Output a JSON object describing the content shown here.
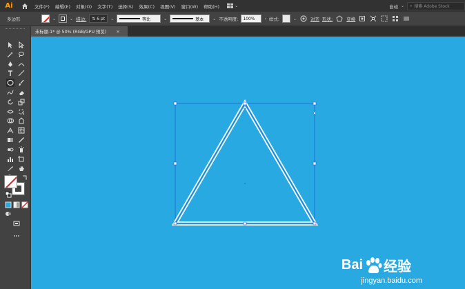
{
  "app": {
    "logo": "Ai"
  },
  "menu": [
    "文件(F)",
    "编辑(E)",
    "对象(O)",
    "文字(T)",
    "选择(S)",
    "效果(C)",
    "视图(V)",
    "窗口(W)",
    "帮助(H)"
  ],
  "menubar_right": {
    "workspace": "自动",
    "search_placeholder": "搜索 Adobe Stock"
  },
  "controlbar": {
    "object_type": "多边形",
    "stroke_label": "描边:",
    "stroke_weight": "6 pt",
    "profile": "等比",
    "brush": "基本",
    "opacity_label": "不透明度:",
    "opacity_value": "100%",
    "style_label": "样式:",
    "align_label": "对齐",
    "shape_label": "形状:",
    "transform_label": "变换"
  },
  "document": {
    "tab_title": "未标题-1* @ 50% (RGB/GPU 预览)",
    "close": "×"
  },
  "colors": {
    "canvas": "#29a9e1",
    "shape_stroke": "#ffffff",
    "selection": "#1a5fd8"
  },
  "watermark": {
    "logo_text_1": "Bai",
    "logo_text_2": "经验",
    "url": "jingyan.baidu.com"
  }
}
